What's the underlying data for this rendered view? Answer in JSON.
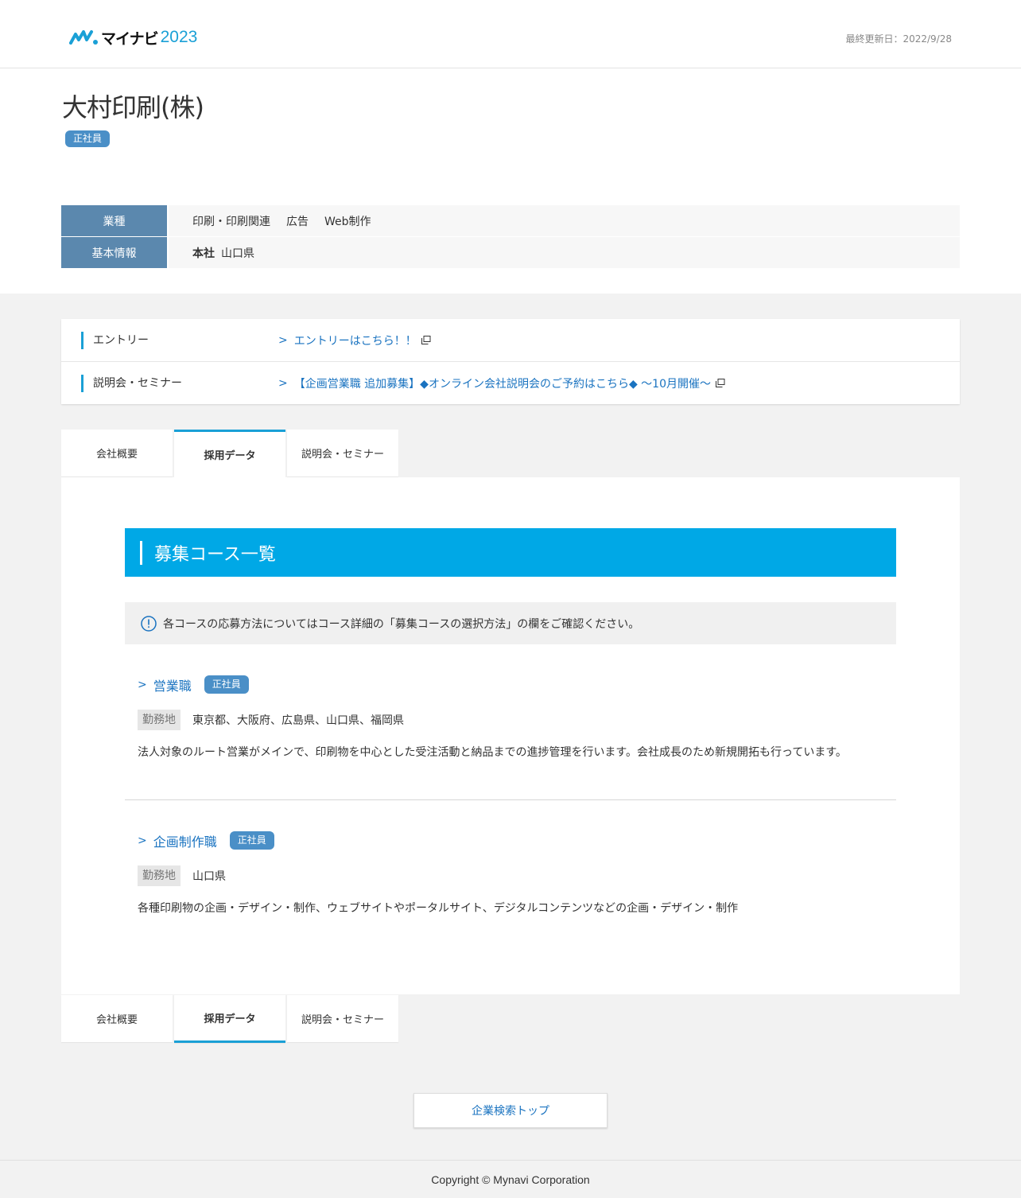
{
  "header": {
    "logo_name": "マイナビ",
    "logo_year": "2023",
    "updated_label": "最終更新日：",
    "updated_date": "2022/9/28"
  },
  "company": {
    "name": "大村印刷(株)",
    "employment_badge": "正社員"
  },
  "info": {
    "industry_label": "業種",
    "industries": [
      "印刷・印刷関連",
      "広告",
      "Web制作"
    ],
    "basic_label": "基本情報",
    "hq_label": "本社",
    "hq_value": "山口県"
  },
  "entries": {
    "entry_label": "エントリー",
    "entry_link": "エントリーはこちら！！",
    "seminar_label": "説明会・セミナー",
    "seminar_link": "【企画営業職 追加募集】◆オンライン会社説明会のご予約はこちら◆ ～10月開催～"
  },
  "tabs": {
    "overview": "会社概要",
    "recruit": "採用データ",
    "seminar": "説明会・セミナー"
  },
  "courses": {
    "heading": "募集コース一覧",
    "notice": "各コースの応募方法についてはコース詳細の「募集コースの選択方法」の欄をご確認ください。",
    "location_label": "勤務地",
    "items": [
      {
        "title": "営業職",
        "badge": "正社員",
        "location": "東京都、大阪府、広島県、山口県、福岡県",
        "description": "法人対象のルート営業がメインで、印刷物を中心とした受注活動と納品までの進捗管理を行います。会社成長のため新規開拓も行っています。"
      },
      {
        "title": "企画制作職",
        "badge": "正社員",
        "location": "山口県",
        "description": "各種印刷物の企画・デザイン・制作、ウェブサイトやポータルサイト、デジタルコンテンツなどの企画・デザイン・制作"
      }
    ]
  },
  "search_top_label": "企業検索トップ",
  "footer": "Copyright © Mynavi Corporation",
  "colors": {
    "accent": "#00a8e6",
    "link": "#1a73c0",
    "badge": "#4a8fc7",
    "table_head": "#5b88ae"
  }
}
